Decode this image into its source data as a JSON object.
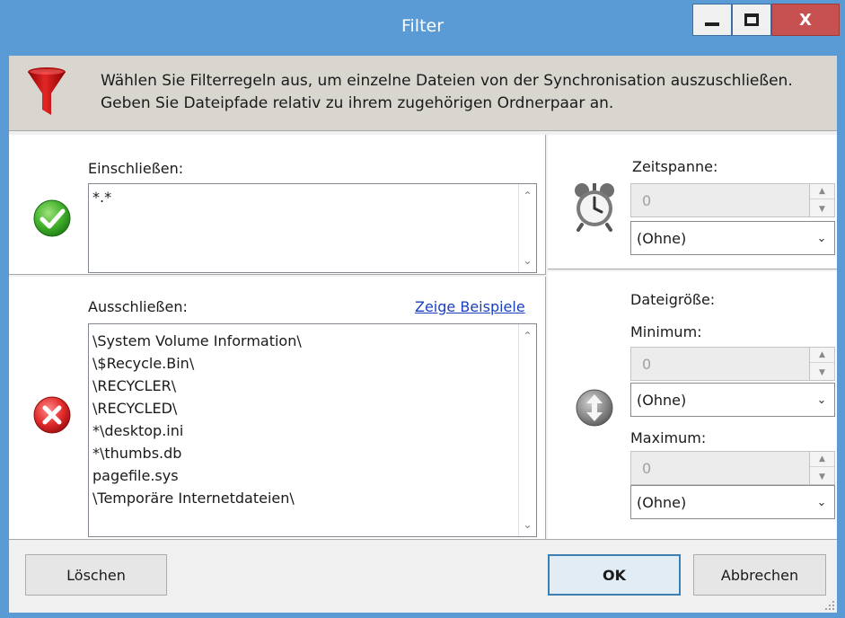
{
  "window": {
    "title": "Filter",
    "close_label": "X"
  },
  "header": {
    "line1": "Wählen Sie Filterregeln aus, um einzelne Dateien von der Synchronisation auszuschließen.",
    "line2": "Geben Sie Dateipfade relativ zu ihrem zugehörigen Ordnerpaar an."
  },
  "include": {
    "label": "Einschließen:",
    "lines": [
      "*.*"
    ]
  },
  "exclude": {
    "label": "Ausschließen:",
    "examples_link": "Zeige Beispiele",
    "lines": [
      "\\System Volume Information\\",
      "\\$Recycle.Bin\\",
      "\\RECYCLER\\",
      "\\RECYCLED\\",
      "*\\desktop.ini",
      "*\\thumbs.db",
      "pagefile.sys",
      "\\Temporäre Internetdateien\\"
    ]
  },
  "timespan": {
    "label": "Zeitspanne:",
    "value": "0",
    "unit": "(Ohne)"
  },
  "filesize": {
    "label": "Dateigröße:",
    "min_label": "Minimum:",
    "min_value": "0",
    "min_unit": "(Ohne)",
    "max_label": "Maximum:",
    "max_value": "0",
    "max_unit": "(Ohne)"
  },
  "buttons": {
    "clear": "Löschen",
    "ok": "OK",
    "cancel": "Abbrechen"
  },
  "icons": {
    "header": "funnel-icon",
    "include": "checkmark-icon",
    "exclude": "cross-icon",
    "timespan": "alarm-clock-icon",
    "filesize": "up-down-arrows-icon"
  },
  "colors": {
    "titlebar": "#5b9bd5",
    "close_button": "#c75050",
    "header_bg": "#d9d6d0",
    "link": "#1a3fbf",
    "ok_border": "#3c7fb1"
  }
}
